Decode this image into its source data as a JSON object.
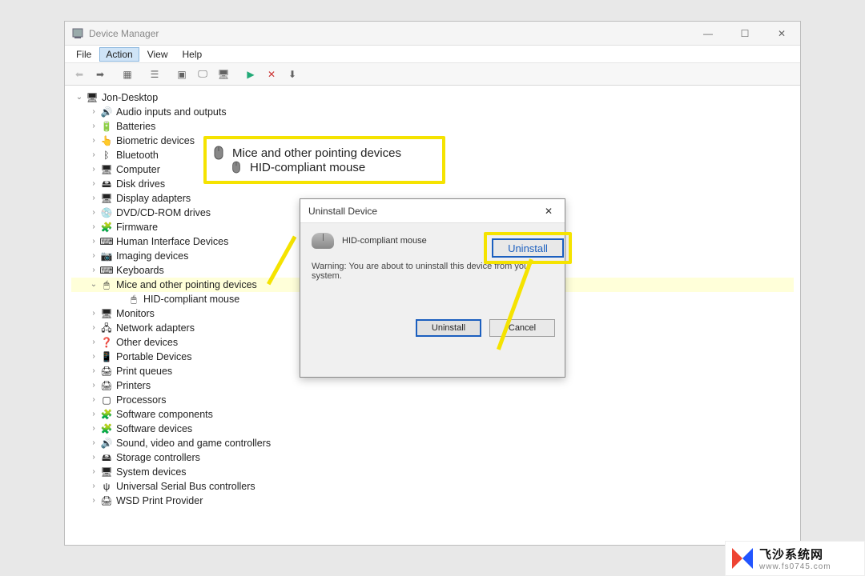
{
  "window": {
    "title": "Device Manager",
    "controls": {
      "min": "—",
      "max": "☐",
      "close": "✕"
    }
  },
  "menubar": [
    "File",
    "Action",
    "View",
    "Help"
  ],
  "menubar_selected_index": 1,
  "root_node": "Jon-Desktop",
  "device_categories": [
    {
      "label": "Audio inputs and outputs",
      "icon": "🔊"
    },
    {
      "label": "Batteries",
      "icon": "🔋"
    },
    {
      "label": "Biometric devices",
      "icon": "👆"
    },
    {
      "label": "Bluetooth",
      "icon": "ᛒ"
    },
    {
      "label": "Computer",
      "icon": "🖥"
    },
    {
      "label": "Disk drives",
      "icon": "🖴"
    },
    {
      "label": "Display adapters",
      "icon": "🖥"
    },
    {
      "label": "DVD/CD-ROM drives",
      "icon": "💿"
    },
    {
      "label": "Firmware",
      "icon": "🧩"
    },
    {
      "label": "Human Interface Devices",
      "icon": "⌨"
    },
    {
      "label": "Imaging devices",
      "icon": "📷"
    },
    {
      "label": "Keyboards",
      "icon": "⌨"
    },
    {
      "label": "Mice and other pointing devices",
      "icon": "🖱",
      "expanded": true,
      "children": [
        {
          "label": "HID-compliant mouse",
          "icon": "🖱"
        }
      ]
    },
    {
      "label": "Monitors",
      "icon": "🖥"
    },
    {
      "label": "Network adapters",
      "icon": "🖧"
    },
    {
      "label": "Other devices",
      "icon": "❓"
    },
    {
      "label": "Portable Devices",
      "icon": "📱"
    },
    {
      "label": "Print queues",
      "icon": "🖨"
    },
    {
      "label": "Printers",
      "icon": "🖨"
    },
    {
      "label": "Processors",
      "icon": "▢"
    },
    {
      "label": "Software components",
      "icon": "🧩"
    },
    {
      "label": "Software devices",
      "icon": "🧩"
    },
    {
      "label": "Sound, video and game controllers",
      "icon": "🔊"
    },
    {
      "label": "Storage controllers",
      "icon": "🖴"
    },
    {
      "label": "System devices",
      "icon": "🖥"
    },
    {
      "label": "Universal Serial Bus controllers",
      "icon": "ψ"
    },
    {
      "label": "WSD Print Provider",
      "icon": "🖨"
    }
  ],
  "callout": {
    "category": "Mice and other pointing devices",
    "device": "HID-compliant mouse"
  },
  "dialog": {
    "title": "Uninstall Device",
    "device_name": "HID-compliant mouse",
    "warning": "Warning: You are about to uninstall this device from your system.",
    "buttons": {
      "primary": "Uninstall",
      "cancel": "Cancel"
    }
  },
  "uninstall_callout_label": "Uninstall",
  "watermark": {
    "brand": "飞沙系统网",
    "url": "www.fs0745.com"
  }
}
